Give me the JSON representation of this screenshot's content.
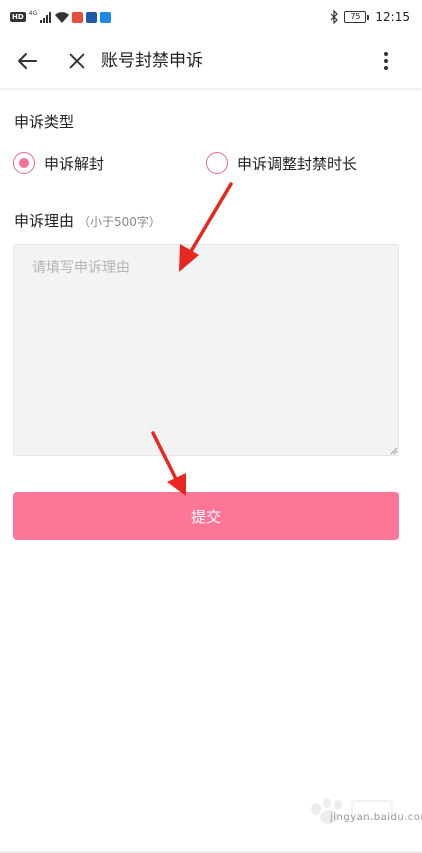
{
  "status_bar": {
    "time": "12:15",
    "battery": "75",
    "hd": "HD",
    "signal": "4G",
    "app_colors": [
      "#e74c3c",
      "#1e5aa8",
      "#1e88e5"
    ]
  },
  "nav": {
    "title": "账号封禁申诉",
    "back_icon": "arrow-left-icon",
    "close_icon": "close-icon",
    "more_icon": "more-vertical-icon"
  },
  "form": {
    "type_label": "申诉类型",
    "options": [
      {
        "label": "申诉解封",
        "selected": true
      },
      {
        "label": "申诉调整封禁时长",
        "selected": false
      }
    ],
    "reason_label": "申诉理由",
    "reason_hint": "（小于500字）",
    "reason_placeholder": "请填写申诉理由",
    "reason_value": "",
    "submit_label": "提交"
  },
  "watermark": {
    "text": "jingyan.baidu.com"
  },
  "colors": {
    "accent": "#fd7698",
    "radio_border": "#e86a8a",
    "annotation_arrow": "#e8281e"
  }
}
